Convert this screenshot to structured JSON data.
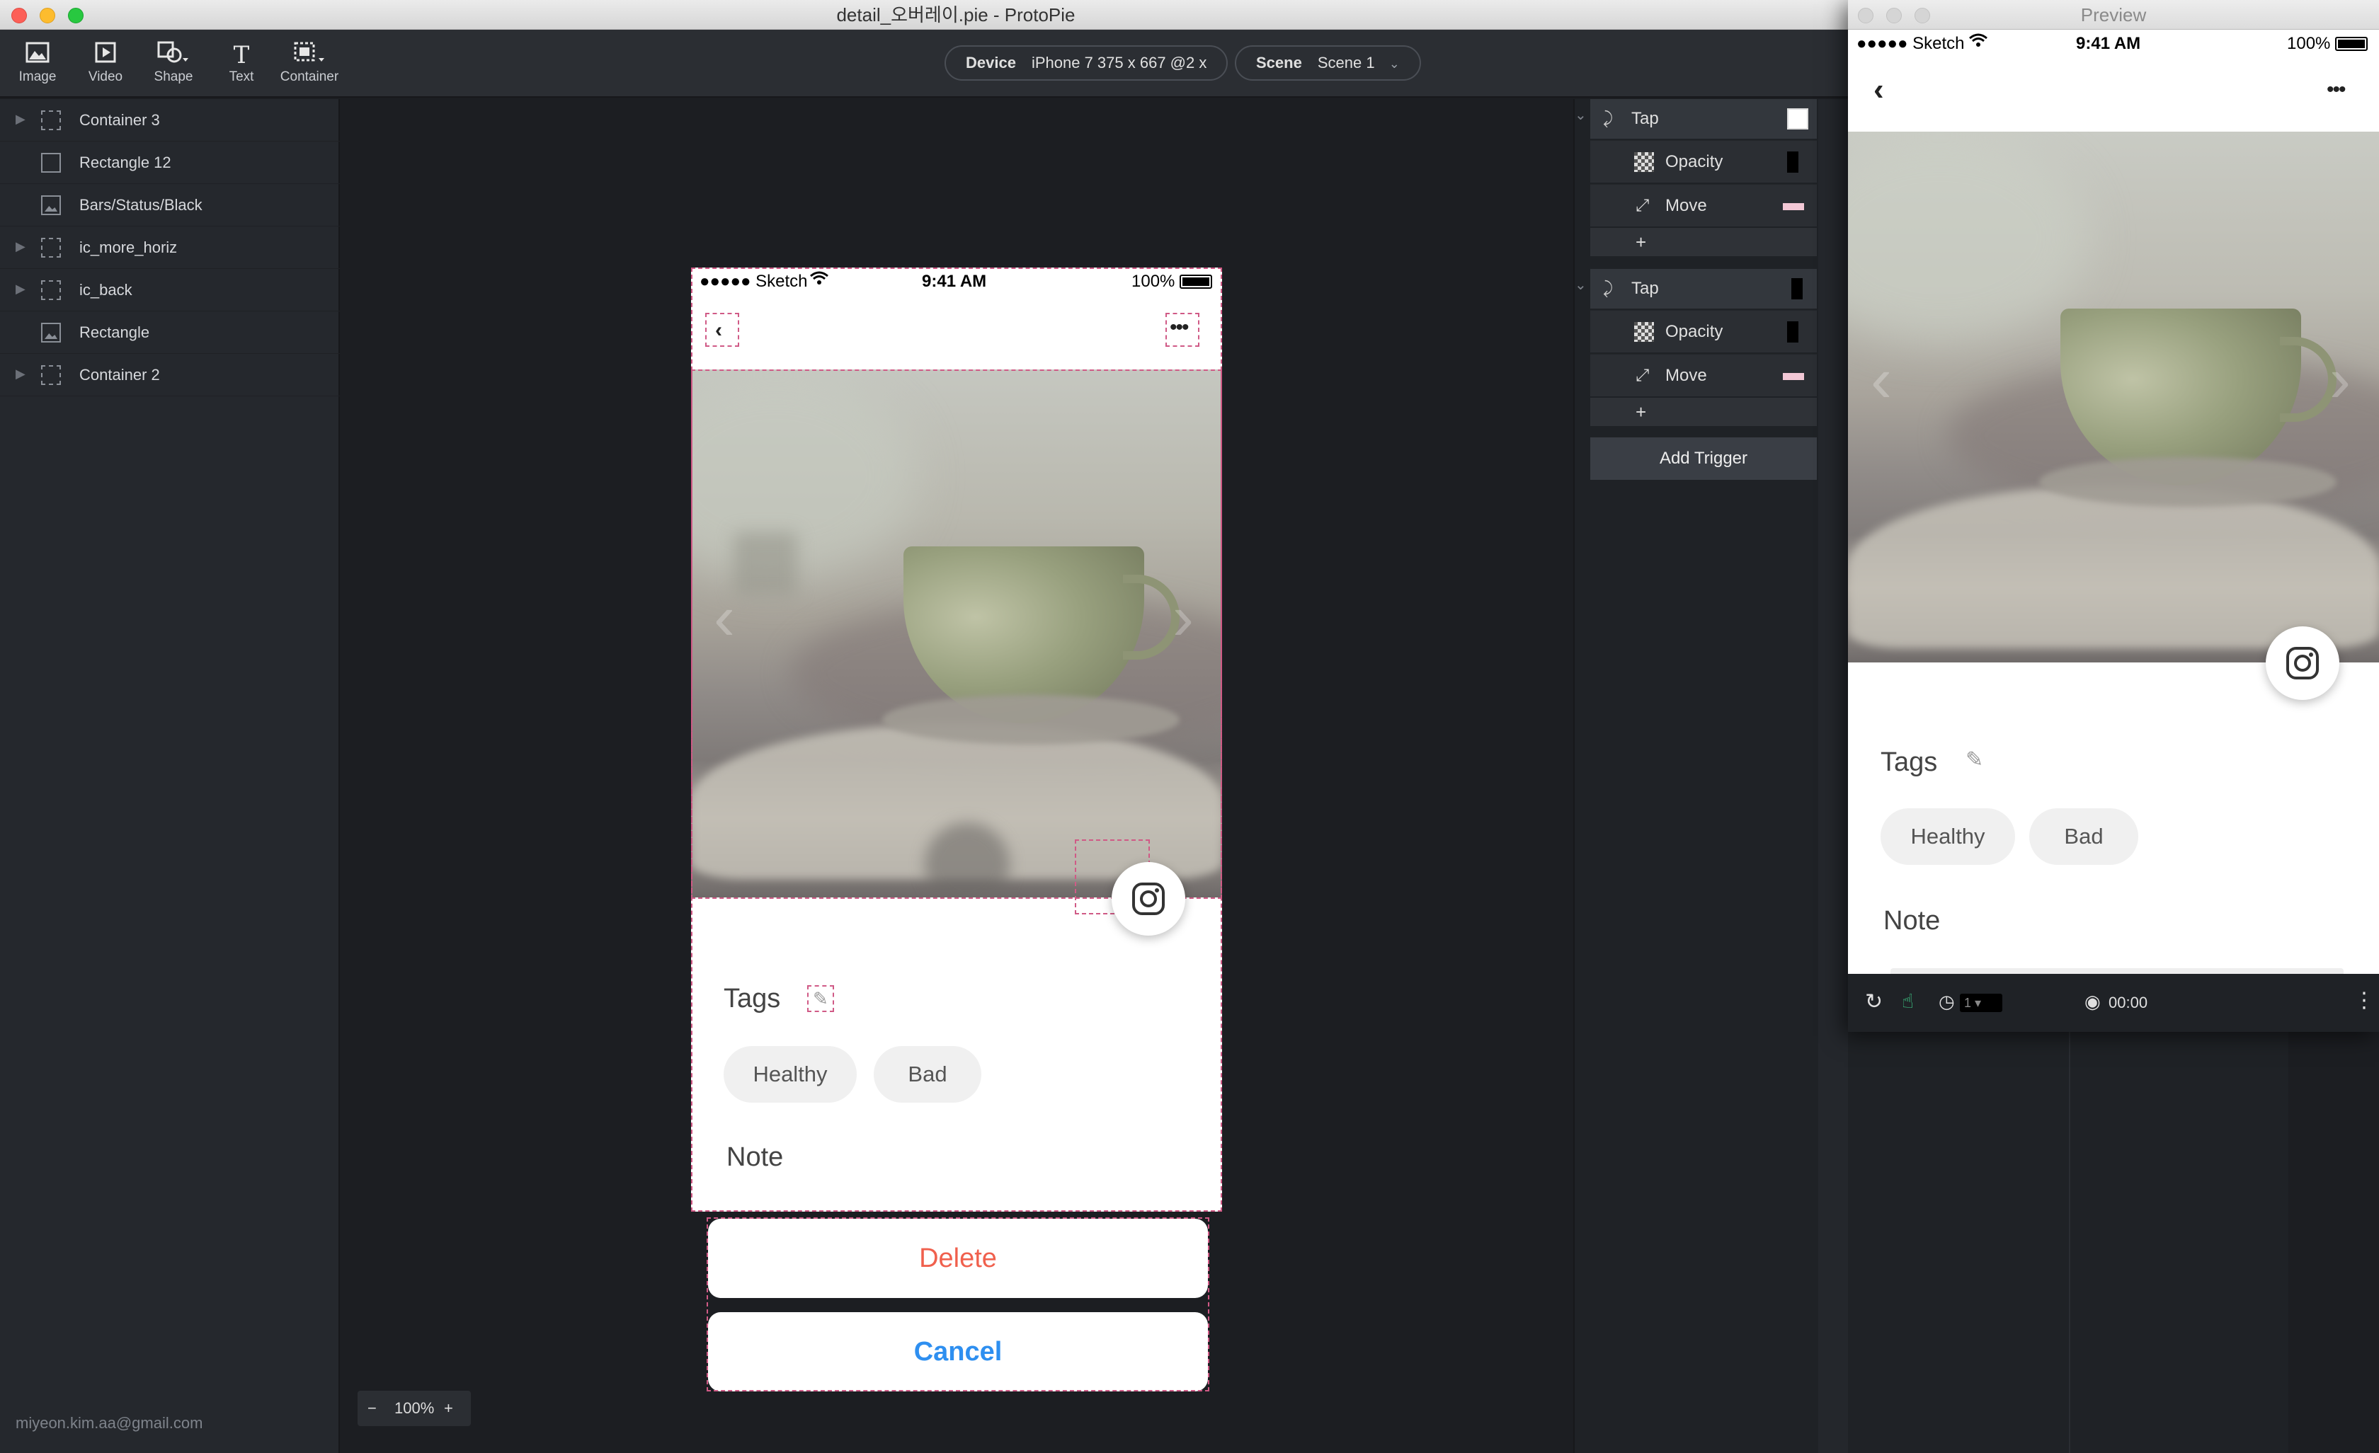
{
  "window": {
    "title": "detail_오버레이.pie - ProtoPie"
  },
  "toolbar": {
    "tools": [
      {
        "label": "Image",
        "icon": "image-icon"
      },
      {
        "label": "Video",
        "icon": "video-icon"
      },
      {
        "label": "Shape",
        "icon": "shape-icon"
      },
      {
        "label": "Text",
        "icon": "text-icon"
      },
      {
        "label": "Container",
        "icon": "container-icon"
      }
    ],
    "device_label": "Device",
    "device_value": "iPhone 7  375 x 667  @2 x",
    "scene_label": "Scene",
    "scene_value": "Scene 1"
  },
  "layers": [
    {
      "name": "Container 3",
      "type": "container",
      "expandable": true
    },
    {
      "name": "Rectangle 12",
      "type": "rectangle",
      "expandable": false
    },
    {
      "name": "Bars/Status/Black",
      "type": "image",
      "expandable": false
    },
    {
      "name": "ic_more_horiz",
      "type": "container",
      "expandable": true
    },
    {
      "name": "ic_back",
      "type": "container",
      "expandable": true
    },
    {
      "name": "Rectangle",
      "type": "image",
      "expandable": false
    },
    {
      "name": "Container 2",
      "type": "container",
      "expandable": true
    }
  ],
  "user_email": "miyeon.kim.aa@gmail.com",
  "zoom": {
    "value": "100%",
    "minus": "−",
    "plus": "+"
  },
  "phone": {
    "status": {
      "carrier": "●●●●● Sketch",
      "time": "9:41 AM",
      "battery": "100%"
    },
    "tags_label": "Tags",
    "tags": [
      "Healthy",
      "Bad"
    ],
    "note_label": "Note"
  },
  "actions": {
    "delete": "Delete",
    "cancel": "Cancel"
  },
  "interactions": {
    "triggers": [
      {
        "name": "Tap",
        "responses": [
          "Opacity",
          "Move"
        ],
        "add": "+"
      },
      {
        "name": "Tap",
        "responses": [
          "Opacity",
          "Move"
        ],
        "add": "+"
      }
    ],
    "add_trigger": "Add Trigger"
  },
  "preview": {
    "title": "Preview",
    "status": {
      "carrier": "●●●●● Sketch",
      "time": "9:41 AM",
      "battery": "100%"
    },
    "tags_label": "Tags",
    "tags": [
      "Healthy",
      "Bad"
    ],
    "note_label": "Note",
    "timer": "00:00",
    "speed": "1"
  },
  "colors": {
    "delete": "#f0604d",
    "cancel": "#2e8ff0",
    "selection": "#d05a86",
    "accent_green": "#3fd08a"
  }
}
